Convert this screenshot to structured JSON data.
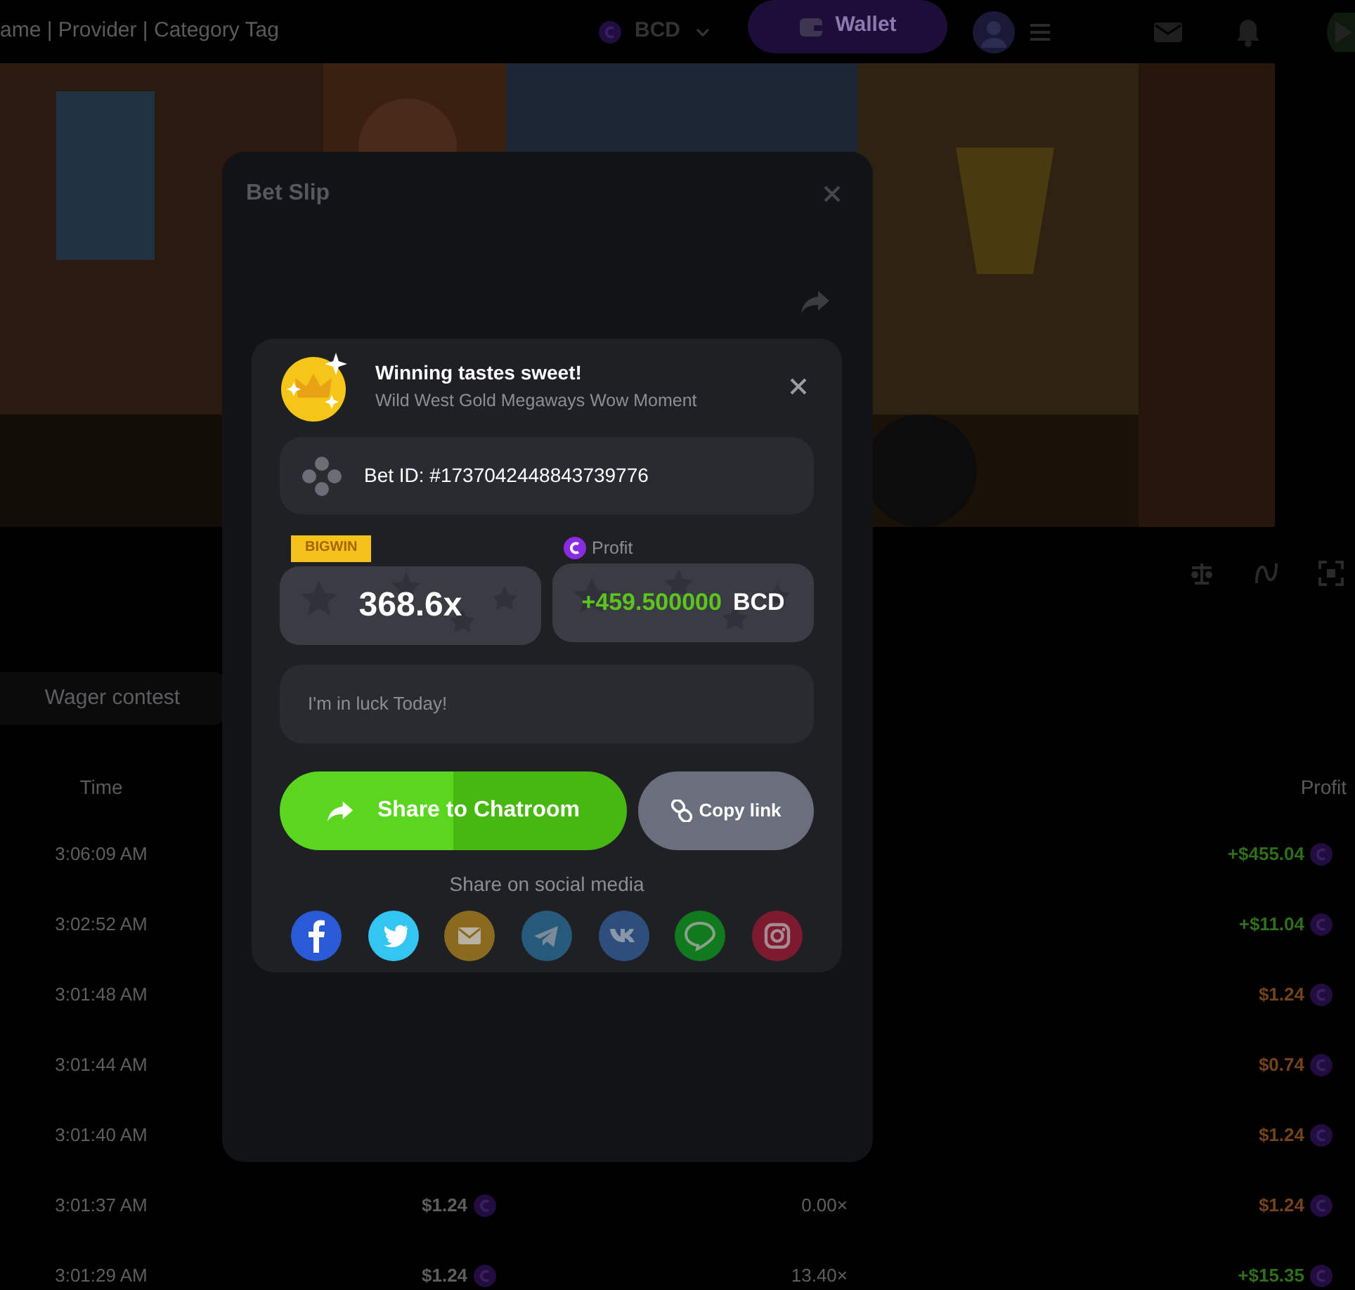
{
  "top_bar": {
    "search_text": "ame | Provider | Category Tag",
    "currency": "BCD",
    "wallet_button": "Wallet"
  },
  "contest_tab": {
    "label": "Wager contest"
  },
  "table": {
    "time_header": "Time",
    "profit_header": "Profit",
    "rows": [
      {
        "time": "3:06:09 AM",
        "profit": "+$455.04",
        "color": "#2f6e1a"
      },
      {
        "time": "3:02:52 AM",
        "profit": "+$11.04",
        "color": "#2f6e1a"
      },
      {
        "time": "3:01:48 AM",
        "profit": "$1.24",
        "color": "#744218"
      },
      {
        "time": "3:01:44 AM",
        "profit": "$0.74",
        "color": "#744218"
      },
      {
        "time": "3:01:40 AM",
        "profit": "$1.24",
        "color": "#744218"
      },
      {
        "time": "3:01:37 AM",
        "bet": "$1.24",
        "multiplier": "0.00×",
        "profit": "$1.24",
        "color": "#744218"
      },
      {
        "time": "3:01:29 AM",
        "bet": "$1.24",
        "multiplier": "13.40×",
        "profit": "+$15.35",
        "color": "#2f6e1a"
      }
    ]
  },
  "bet_slip": {
    "title": "Bet Slip"
  },
  "share_card": {
    "title": "Winning tastes sweet!",
    "subtitle": "Wild West Gold Megaways Wow Moment",
    "bet_id": "Bet ID: #1737042448843739776",
    "badge": "BIGWIN",
    "multiplier": "368.6x",
    "profit_label": "Profit",
    "profit_amount": "+459.500000",
    "profit_currency": "BCD",
    "message_placeholder": "I'm in luck Today!",
    "share_button": "Share to Chatroom",
    "copy_button": "Copy link",
    "social_heading": "Share on social media",
    "social": [
      {
        "kind": "facebook",
        "color": "#2a5ad6"
      },
      {
        "kind": "twitter",
        "color": "#33c6f3"
      },
      {
        "kind": "email",
        "color": "#8a6a1e"
      },
      {
        "kind": "telegram",
        "color": "#265a7a"
      },
      {
        "kind": "vk",
        "color": "#2e4f7e"
      },
      {
        "kind": "line",
        "color": "#127a1e"
      },
      {
        "kind": "instagram",
        "color": "#7e1a30"
      }
    ]
  }
}
